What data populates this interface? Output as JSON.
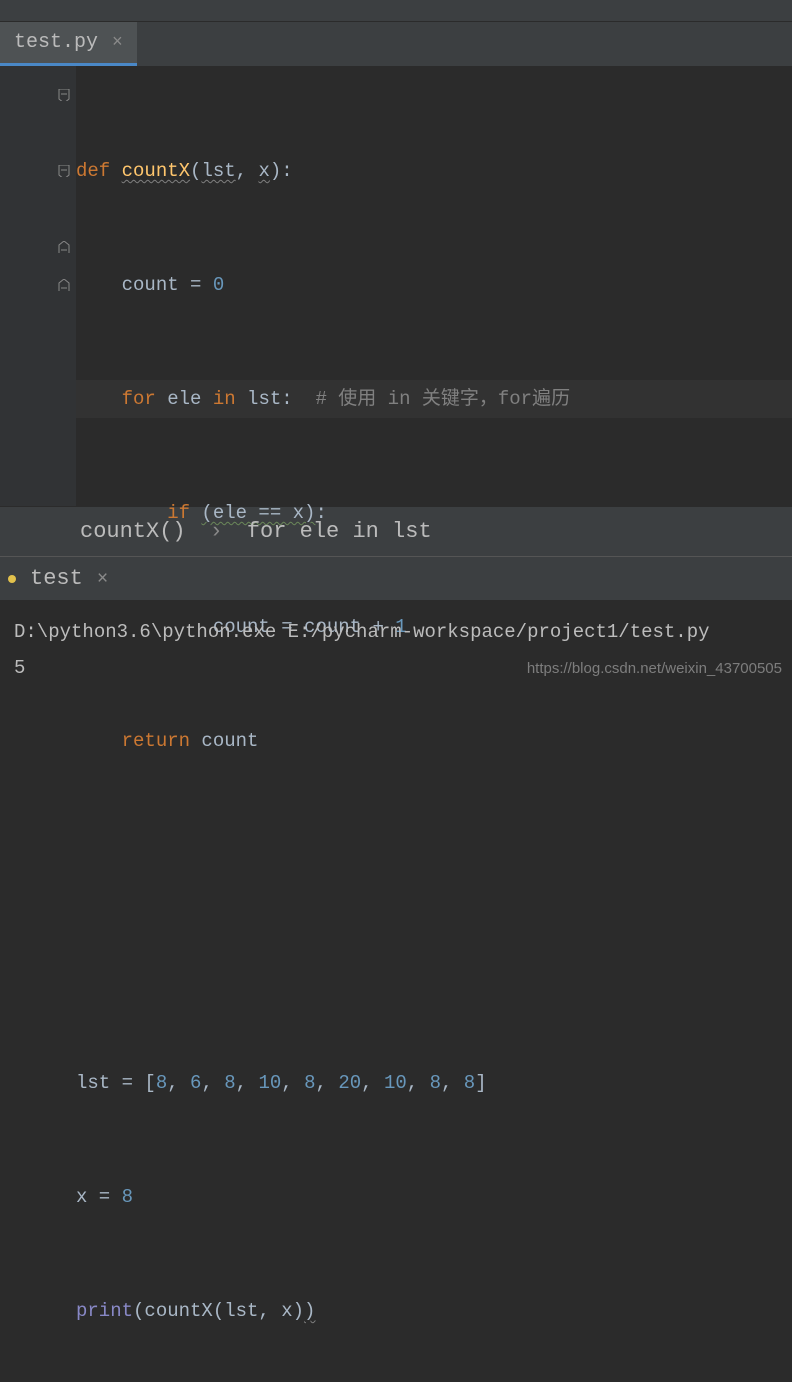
{
  "tab": {
    "name": "test.py",
    "close": "×"
  },
  "code": {
    "l1_def": "def ",
    "l1_fn": "countX",
    "l1_open": "(",
    "l1_p1": "lst",
    "l1_comma": ", ",
    "l1_p2": "x",
    "l1_close": "):",
    "l2_a": "    count = ",
    "l2_b": "0",
    "l3_for": "    for ",
    "l3_ele": "ele ",
    "l3_in": "in ",
    "l3_lst": "lst:  ",
    "l3_cmt": "# 使用 in 关键字，for遍历",
    "l4_if": "        if ",
    "l4_cond": "(ele == x)",
    "l4_colon": ":",
    "l5": "            count = count + ",
    "l5_n": "1",
    "l6_ret": "    return ",
    "l6_var": "count",
    "l9_a": "lst = [",
    "l9_vals": "8, 6, 8, 10, 8, 20, 10, 8, 8",
    "l9_b": "]",
    "l10_a": "x = ",
    "l10_b": "8",
    "l11_print": "print",
    "l11_a": "(countX(lst, x)",
    "l11_b": ")"
  },
  "breadcrumb": {
    "a": "countX()",
    "chev": "›",
    "b": "for ele in lst"
  },
  "runTab": {
    "name": "test",
    "close": "×"
  },
  "console": {
    "line1": "D:\\python3.6\\python.exe E:/pycharm-workspace/project1/test.py",
    "line2": "5"
  },
  "watermark": "https://blog.csdn.net/weixin_43700505"
}
